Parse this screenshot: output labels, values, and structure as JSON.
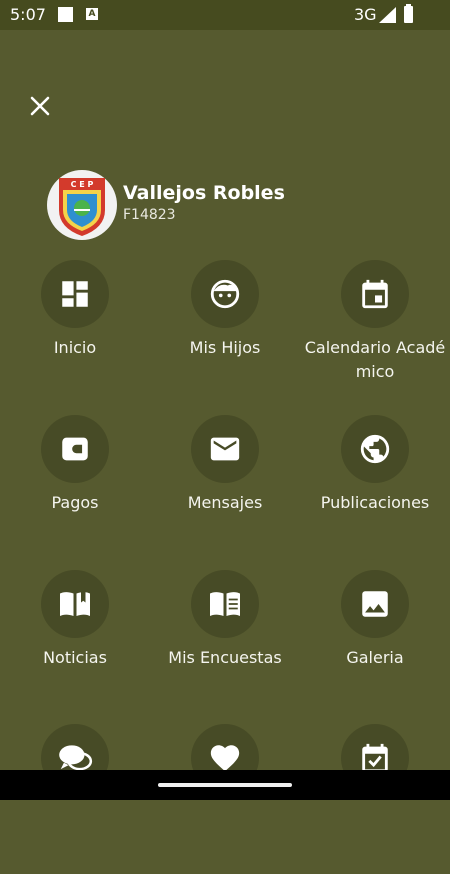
{
  "status_bar": {
    "time": "5:07",
    "network": "3G"
  },
  "colors": {
    "background": "#565a2f",
    "status_bar": "#464b1f",
    "circle": "#474b26",
    "icon": "#ffffff"
  },
  "profile": {
    "name": "Vallejos Robles",
    "code": "F14823",
    "logo_text": "C E P"
  },
  "menu": [
    {
      "label": "Inicio",
      "icon": "dashboard-icon"
    },
    {
      "label": "Mis Hijos",
      "icon": "child-face-icon"
    },
    {
      "label": "Calendario Académico",
      "icon": "calendar-icon"
    },
    {
      "label": "Pagos",
      "icon": "wallet-icon"
    },
    {
      "label": "Mensajes",
      "icon": "mail-icon"
    },
    {
      "label": "Publicaciones",
      "icon": "globe-icon"
    },
    {
      "label": "Noticias",
      "icon": "open-book-icon"
    },
    {
      "label": "Mis Encuestas",
      "icon": "menu-book-icon"
    },
    {
      "label": "Galeria",
      "icon": "image-icon"
    },
    {
      "label": "",
      "icon": "chat-bubbles-icon"
    },
    {
      "label": "",
      "icon": "heart-icon"
    },
    {
      "label": "",
      "icon": "event-check-icon"
    }
  ]
}
